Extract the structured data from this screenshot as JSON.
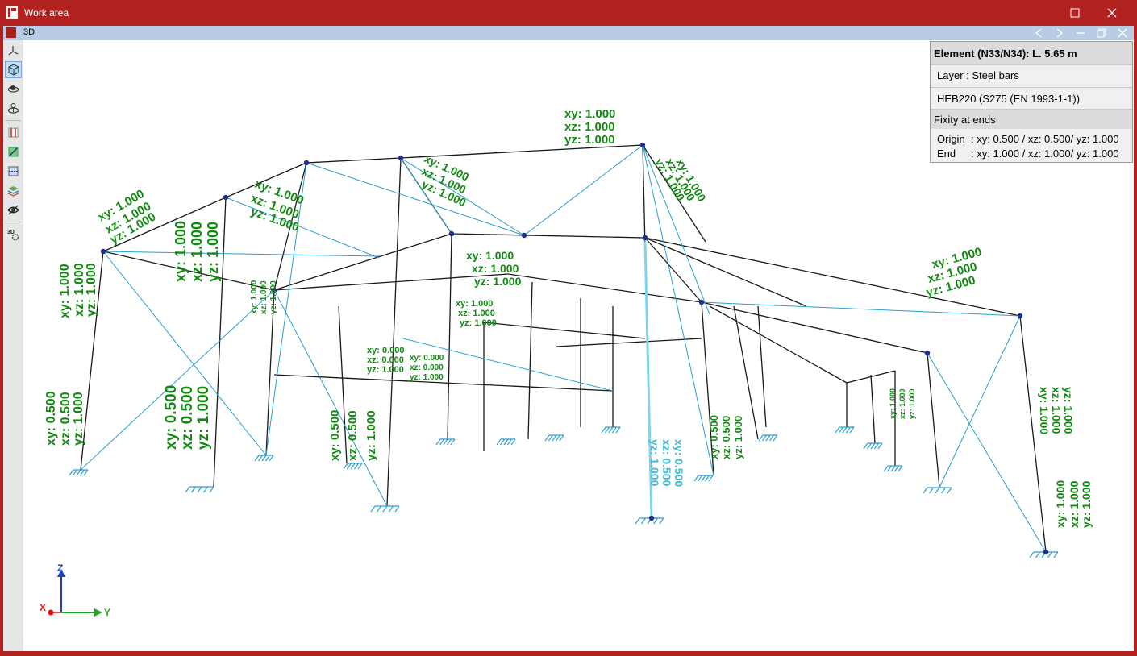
{
  "window": {
    "title": "Work area",
    "tab_label": "3D",
    "colors": {
      "frame": "#b1211f",
      "tabbar": "#b8cde4",
      "canvas": "#ffffff"
    }
  },
  "toolbar": {
    "tools": [
      {
        "icon": "axes-icon",
        "active": false
      },
      {
        "icon": "cube-view-icon",
        "active": true
      },
      {
        "icon": "orbit-icon",
        "active": false
      },
      {
        "icon": "pan-icon",
        "active": false
      },
      {
        "icon": "column-view-icon",
        "active": false
      },
      {
        "icon": "plane-view-icon",
        "active": false
      },
      {
        "icon": "window-view-icon",
        "active": false
      },
      {
        "icon": "layers-icon",
        "active": false
      },
      {
        "icon": "visibility-eye-icon",
        "active": false
      },
      {
        "icon": "3d-settings-icon",
        "active": false
      }
    ]
  },
  "info_panel": {
    "title": "Element (N33/N34): L. 5.65 m",
    "layer": "Layer : Steel bars",
    "section": "HEB220 (S275 (EN 1993-1-1))",
    "fixity_header": "Fixity at ends",
    "origin_key": "Origin",
    "origin_value": ": xy: 0.500 / xz: 0.500/ yz: 1.000",
    "end_key": "End",
    "end_value": ": xy: 1.000 / xz: 1.000/ yz: 1.000"
  },
  "axes": {
    "z": "Z",
    "x": "X",
    "y": "Y"
  },
  "scene": {
    "label_color": "#128a12",
    "selected_label_color": "#3fbdd6",
    "structure_color": "#1a1a1a",
    "bracing_color": "#2a9fd0",
    "labels": [
      {
        "text": "xy: 1.000",
        "size": 15,
        "rot": 0
      },
      {
        "text": "xz: 1.000",
        "size": 15,
        "rot": 0
      },
      {
        "text": "yz: 1.000",
        "size": 15,
        "rot": 0
      },
      {
        "text": "xy: 1.000",
        "size": 16,
        "rot": -90
      },
      {
        "text": "xz: 1.000",
        "size": 16,
        "rot": -90
      },
      {
        "text": "yz: 1.000",
        "size": 16,
        "rot": -90
      },
      {
        "text": "xy: 0.500",
        "size": 16,
        "rot": -90
      },
      {
        "text": "xz: 0.500",
        "size": 16,
        "rot": -90
      },
      {
        "text": "yz: 1.000",
        "size": 16,
        "rot": -90
      },
      {
        "text": "xy: 0.500",
        "size": 19,
        "rot": -90
      },
      {
        "text": "xz: 0.500",
        "size": 19,
        "rot": -90
      },
      {
        "text": "yz: 1.000",
        "size": 19,
        "rot": -90
      },
      {
        "text": "xy: 1.000",
        "size": 18,
        "rot": -90
      },
      {
        "text": "xz: 1.000",
        "size": 18,
        "rot": -90
      },
      {
        "text": "yz: 1.000",
        "size": 18,
        "rot": -90
      },
      {
        "text": "xy: 1.000",
        "size": 15,
        "rot": -30
      },
      {
        "text": "xz: 1.000",
        "size": 15,
        "rot": -30
      },
      {
        "text": "yz: 1.000",
        "size": 15,
        "rot": -30
      },
      {
        "text": "xy: 1.000",
        "size": 15,
        "rot": 20
      },
      {
        "text": "xz: 1.000",
        "size": 15,
        "rot": 20
      },
      {
        "text": "yz: 1.000",
        "size": 15,
        "rot": 20
      },
      {
        "text": "xy: 1.000",
        "size": 14,
        "rot": 25
      },
      {
        "text": "xz: 1.000",
        "size": 14,
        "rot": 25
      },
      {
        "text": "yz: 1.000",
        "size": 14,
        "rot": 25
      },
      {
        "text": "xy: 1.000",
        "size": 14,
        "rot": 0
      },
      {
        "text": "xz: 1.000",
        "size": 14,
        "rot": 0
      },
      {
        "text": "yz: 1.000",
        "size": 14,
        "rot": 0
      },
      {
        "text": "xy: 1.000",
        "size": 11,
        "rot": 0
      },
      {
        "text": "xz: 1.000",
        "size": 11,
        "rot": 0
      },
      {
        "text": "yz: 1.000",
        "size": 11,
        "rot": 0
      },
      {
        "text": "xy: 0.000",
        "size": 11,
        "rot": 0
      },
      {
        "text": "xz: 0.000",
        "size": 11,
        "rot": 0
      },
      {
        "text": "yz: 1.000",
        "size": 11,
        "rot": 0
      },
      {
        "text": "xy: 0.000",
        "size": 10,
        "rot": 0
      },
      {
        "text": "xz: 0.000",
        "size": 10,
        "rot": 0
      },
      {
        "text": "yz: 1.000",
        "size": 10,
        "rot": 0
      },
      {
        "text": "xy: 1.000",
        "size": 10,
        "rot": -90
      },
      {
        "text": "xz: 1.000",
        "size": 10,
        "rot": -90
      },
      {
        "text": "yz: 1.000",
        "size": 10,
        "rot": -90
      },
      {
        "text": "xy: 0.500",
        "size": 15,
        "rot": -90
      },
      {
        "text": "xz: 0.500",
        "size": 15,
        "rot": -90
      },
      {
        "text": "yz: 1.000",
        "size": 15,
        "rot": -90
      },
      {
        "text": "xy: 0.500",
        "size": 14,
        "rot": 90
      },
      {
        "text": "xz: 0.500",
        "size": 14,
        "rot": 90
      },
      {
        "text": "yz: 1.000",
        "size": 14,
        "rot": 90
      },
      {
        "text": "xy: 1.000",
        "size": 14,
        "rot": 60
      },
      {
        "text": "xz: 1.000",
        "size": 14,
        "rot": 60
      },
      {
        "text": "yz: 1.000",
        "size": 14,
        "rot": 60
      },
      {
        "text": "xy: 1.000",
        "size": 15,
        "rot": -15
      },
      {
        "text": "xz: 1.000",
        "size": 15,
        "rot": -15
      },
      {
        "text": "yz: 1.000",
        "size": 15,
        "rot": -15
      },
      {
        "text": "xy: 1.000",
        "size": 14,
        "rot": 90
      },
      {
        "text": "xz: 1.000",
        "size": 14,
        "rot": 90
      },
      {
        "text": "yz: 1.000",
        "size": 14,
        "rot": 90
      },
      {
        "text": "xy: 1.000",
        "size": 14,
        "rot": -90
      },
      {
        "text": "xz: 1.000",
        "size": 14,
        "rot": -90
      },
      {
        "text": "yz: 1.000",
        "size": 14,
        "rot": -90
      },
      {
        "text": "xy: 0.500",
        "size": 13,
        "rot": -90
      },
      {
        "text": "xz: 0.500",
        "size": 13,
        "rot": -90
      },
      {
        "text": "yz: 1.000",
        "size": 13,
        "rot": -90
      },
      {
        "text": "xy: 1.000",
        "size": 9,
        "rot": -90
      },
      {
        "text": "xz: 1.000",
        "size": 9,
        "rot": -90
      },
      {
        "text": "yz: 1.000",
        "size": 9,
        "rot": -90
      }
    ]
  }
}
